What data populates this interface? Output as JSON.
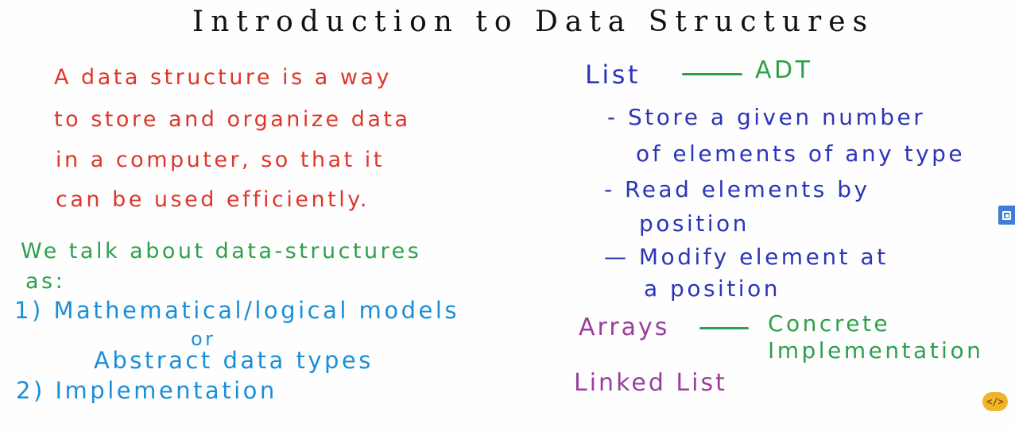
{
  "title": "Introduction to Data Structures",
  "definition": [
    "A data structure is a way",
    "to store and organize data",
    "in a computer, so that it",
    "can be used efficiently."
  ],
  "talk": [
    "We talk about data-structures",
    "as:"
  ],
  "models": {
    "item1": "1) Mathematical/logical models",
    "or": "or",
    "adt": "Abstract data types",
    "item2": "2) Implementation"
  },
  "list_adt": {
    "list_label": "List",
    "adt_label": "ADT",
    "bullets": [
      "- Store a given number",
      "of elements of any type",
      "- Read elements by",
      "position",
      "— Modify element at",
      "a position"
    ]
  },
  "concrete": {
    "arrays": "Arrays",
    "concrete": "Concrete",
    "implementation": "Implementation",
    "linked_list": "Linked List"
  },
  "colors": {
    "title": "#111111",
    "definition": "#e0352a",
    "talk": "#2ea04a",
    "models": "#1a8ed8",
    "list": "#2b35b8",
    "adt": "#2ea04a",
    "concrete_labels": "#9a3e9e"
  },
  "widgets": {
    "side_button_icon": "expand-icon",
    "code_badge": "</>"
  }
}
